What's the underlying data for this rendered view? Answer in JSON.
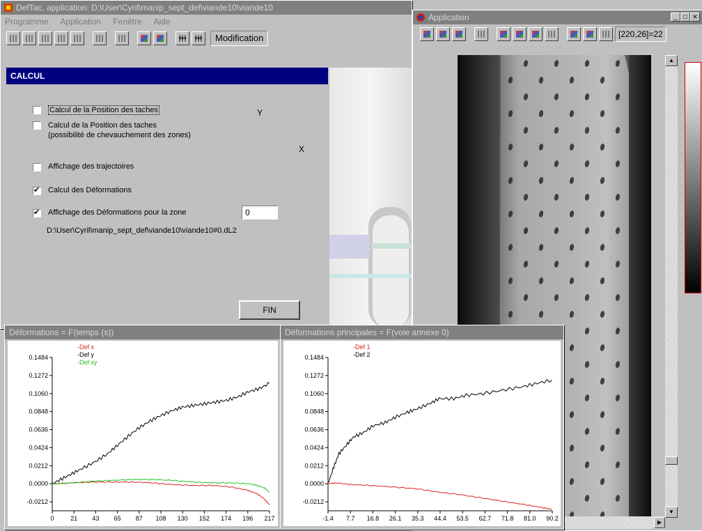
{
  "main_window": {
    "title": "DefTac, application: D:\\User\\Cyril\\manip_sept_def\\viande10\\viande10",
    "menu": [
      "Programme",
      "Application",
      "Fenêtre",
      "Aide"
    ],
    "toolbar_status": "Modification"
  },
  "calcul": {
    "header": "CALCUL",
    "options": [
      {
        "label": "Calcul de la Position des taches",
        "checked": false
      },
      {
        "label": "Calcul de la Position des taches (possibilité de chevauchement des zones)",
        "checked": false
      },
      {
        "label": "Affichage des trajectoires",
        "checked": false
      },
      {
        "label": "Calcul des Déformations",
        "checked": true
      },
      {
        "label": "Affichage des Déformations pour la zone",
        "checked": true
      }
    ],
    "zone_value": "0",
    "file_path": "D:\\User\\Cyril\\manip_sept_def\\viande10\\viande10#0.dL2",
    "axis_y": "Y",
    "axis_x": "X",
    "fin_label": "FIN"
  },
  "app_window": {
    "title": "Application",
    "coords": "[220,26]=22"
  },
  "chart_data": [
    {
      "type": "line",
      "window_title": "Déformations = F(temps (s))",
      "x_ticks": [
        "0",
        "21",
        "43",
        "65",
        "87",
        "108",
        "130",
        "152",
        "174",
        "196",
        "217"
      ],
      "y_ticks": [
        "0.1484",
        "0.1272",
        "0.1060",
        "0.0848",
        "0.0636",
        "0.0424",
        "0.0212",
        "0.0000",
        "-0.0212"
      ],
      "xlim": [
        0,
        217
      ],
      "ylim": [
        -0.0318,
        0.1484
      ],
      "series": [
        {
          "name": "Def x",
          "color": "#e02020",
          "x": [
            0,
            20,
            40,
            60,
            80,
            100,
            120,
            140,
            160,
            180,
            196,
            205,
            212,
            217
          ],
          "y": [
            0.0,
            0.001,
            0.002,
            0.002,
            0.002,
            0.001,
            -0.001,
            -0.002,
            -0.002,
            -0.004,
            -0.008,
            -0.012,
            -0.018,
            -0.025
          ]
        },
        {
          "name": "Def y",
          "color": "#000000",
          "x": [
            0,
            10,
            20,
            30,
            43,
            55,
            65,
            76,
            87,
            98,
            108,
            120,
            130,
            141,
            152,
            163,
            174,
            185,
            196,
            207,
            217
          ],
          "y": [
            0.0,
            0.006,
            0.012,
            0.018,
            0.026,
            0.035,
            0.045,
            0.056,
            0.066,
            0.074,
            0.08,
            0.086,
            0.09,
            0.092,
            0.094,
            0.096,
            0.098,
            0.102,
            0.108,
            0.112,
            0.118
          ]
        },
        {
          "name": "Def xy",
          "color": "#20c020",
          "x": [
            0,
            20,
            40,
            60,
            80,
            100,
            120,
            140,
            160,
            180,
            196,
            205,
            212,
            217
          ],
          "y": [
            0.0,
            0.001,
            0.003,
            0.004,
            0.005,
            0.005,
            0.004,
            0.002,
            0.001,
            0.001,
            0.0,
            -0.002,
            -0.005,
            -0.01
          ]
        }
      ]
    },
    {
      "type": "line",
      "window_title": "Déformations principales = F(voie annexe 0)",
      "x_ticks": [
        "-1.4",
        "7.7",
        "16.8",
        "26.1",
        "35.3",
        "44.4",
        "53.5",
        "62.7",
        "71.8",
        "81.0",
        "90.2"
      ],
      "y_ticks": [
        "0.1484",
        "0.1272",
        "0.1060",
        "0.0848",
        "0.0636",
        "0.0424",
        "0.0212",
        "0.0000",
        "-0.0212"
      ],
      "xlim": [
        -1.4,
        90.2
      ],
      "ylim": [
        -0.0318,
        0.1484
      ],
      "series": [
        {
          "name": "Def 1",
          "color": "#e02020",
          "x": [
            -1.4,
            2,
            8,
            16,
            26,
            35,
            44,
            53,
            62,
            71,
            80,
            86,
            90
          ],
          "y": [
            0.0,
            0.001,
            -0.001,
            -0.002,
            -0.004,
            -0.006,
            -0.01,
            -0.013,
            -0.017,
            -0.021,
            -0.025,
            -0.028,
            -0.03
          ]
        },
        {
          "name": "Def 2",
          "color": "#000000",
          "x": [
            -1.4,
            1,
            3,
            6,
            9,
            13,
            17,
            22,
            26,
            31,
            35,
            40,
            44,
            50,
            55,
            62,
            70,
            78,
            84,
            90
          ],
          "y": [
            0.0,
            0.02,
            0.035,
            0.045,
            0.055,
            0.06,
            0.068,
            0.072,
            0.078,
            0.084,
            0.088,
            0.094,
            0.1,
            0.1,
            0.104,
            0.106,
            0.11,
            0.114,
            0.118,
            0.122
          ]
        }
      ]
    }
  ]
}
